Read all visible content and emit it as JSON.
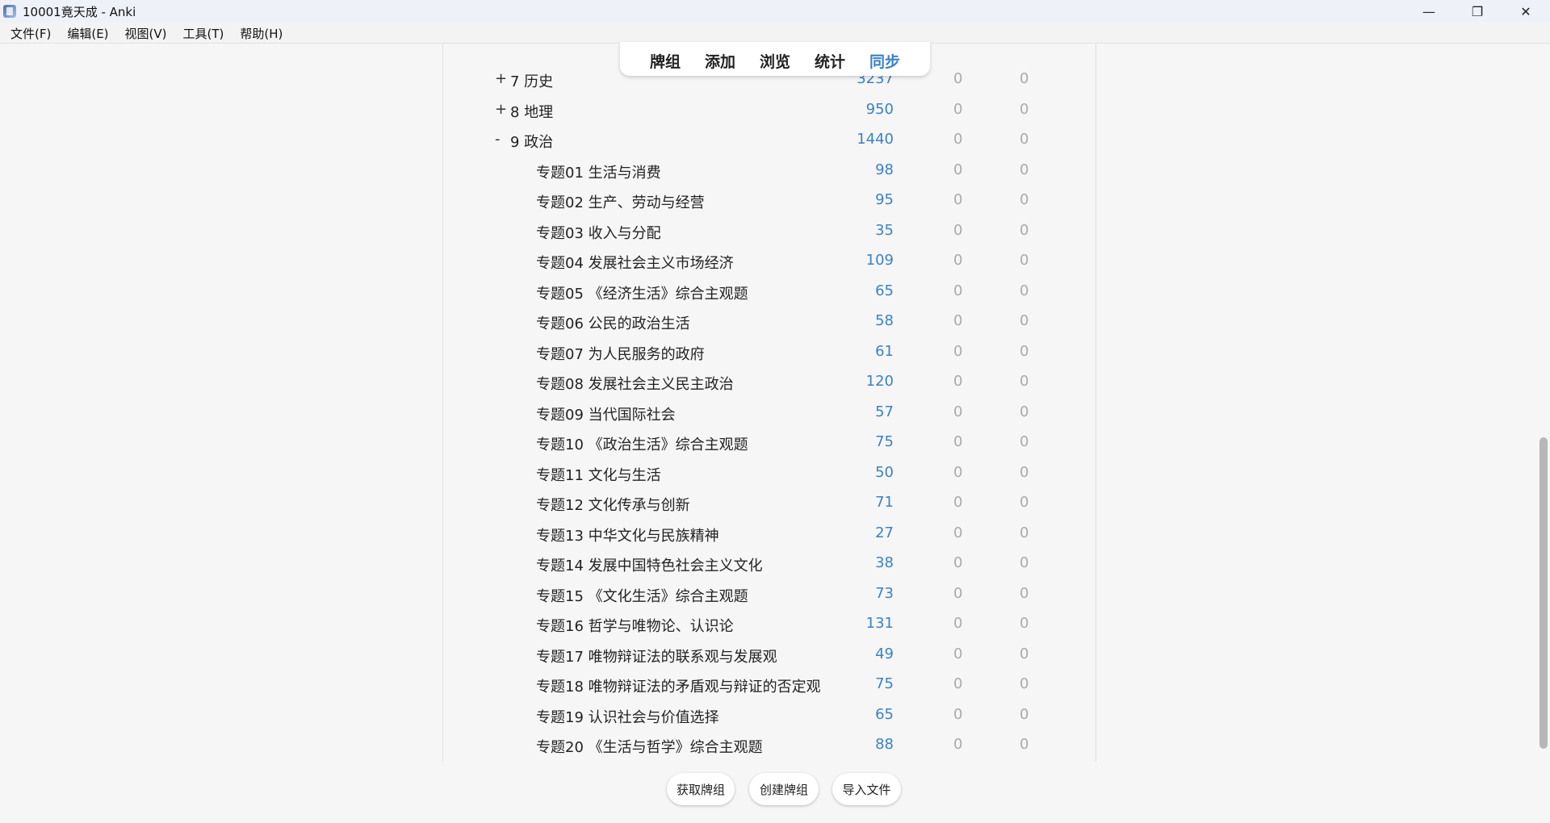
{
  "window": {
    "title": "10001竟天成 - Anki",
    "controls": {
      "minimize": "—",
      "restore": "❐",
      "close": "✕"
    },
    "app_icon": "anki-app-icon"
  },
  "menu": [
    "文件(F)",
    "编辑(E)",
    "视图(V)",
    "工具(T)",
    "帮助(H)"
  ],
  "toolbar": {
    "items": [
      "牌组",
      "添加",
      "浏览",
      "统计",
      "同步"
    ],
    "active_index": 4,
    "active_color": "#3b82c4"
  },
  "decks": [
    {
      "expander": "+",
      "name": "7 历史",
      "new": "3237",
      "learn": "0",
      "due": "0",
      "level": 0
    },
    {
      "expander": "+",
      "name": "8 地理",
      "new": "950",
      "learn": "0",
      "due": "0",
      "level": 0
    },
    {
      "expander": "-",
      "name": "9 政治",
      "new": "1440",
      "learn": "0",
      "due": "0",
      "level": 0
    },
    {
      "expander": "",
      "name": "专题01 生活与消费",
      "new": "98",
      "learn": "0",
      "due": "0",
      "level": 1
    },
    {
      "expander": "",
      "name": "专题02 生产、劳动与经营",
      "new": "95",
      "learn": "0",
      "due": "0",
      "level": 1
    },
    {
      "expander": "",
      "name": "专题03 收入与分配",
      "new": "35",
      "learn": "0",
      "due": "0",
      "level": 1
    },
    {
      "expander": "",
      "name": "专题04 发展社会主义市场经济",
      "new": "109",
      "learn": "0",
      "due": "0",
      "level": 1
    },
    {
      "expander": "",
      "name": "专题05 《经济生活》综合主观题",
      "new": "65",
      "learn": "0",
      "due": "0",
      "level": 1
    },
    {
      "expander": "",
      "name": "专题06 公民的政治生活",
      "new": "58",
      "learn": "0",
      "due": "0",
      "level": 1
    },
    {
      "expander": "",
      "name": "专题07 为人民服务的政府",
      "new": "61",
      "learn": "0",
      "due": "0",
      "level": 1
    },
    {
      "expander": "",
      "name": "专题08 发展社会主义民主政治",
      "new": "120",
      "learn": "0",
      "due": "0",
      "level": 1
    },
    {
      "expander": "",
      "name": "专题09 当代国际社会",
      "new": "57",
      "learn": "0",
      "due": "0",
      "level": 1
    },
    {
      "expander": "",
      "name": "专题10 《政治生活》综合主观题",
      "new": "75",
      "learn": "0",
      "due": "0",
      "level": 1
    },
    {
      "expander": "",
      "name": "专题11 文化与生活",
      "new": "50",
      "learn": "0",
      "due": "0",
      "level": 1
    },
    {
      "expander": "",
      "name": "专题12 文化传承与创新",
      "new": "71",
      "learn": "0",
      "due": "0",
      "level": 1
    },
    {
      "expander": "",
      "name": "专题13 中华文化与民族精神",
      "new": "27",
      "learn": "0",
      "due": "0",
      "level": 1
    },
    {
      "expander": "",
      "name": "专题14 发展中国特色社会主义文化",
      "new": "38",
      "learn": "0",
      "due": "0",
      "level": 1
    },
    {
      "expander": "",
      "name": "专题15 《文化生活》综合主观题",
      "new": "73",
      "learn": "0",
      "due": "0",
      "level": 1
    },
    {
      "expander": "",
      "name": "专题16 哲学与唯物论、认识论",
      "new": "131",
      "learn": "0",
      "due": "0",
      "level": 1
    },
    {
      "expander": "",
      "name": "专题17 唯物辩证法的联系观与发展观",
      "new": "49",
      "learn": "0",
      "due": "0",
      "level": 1
    },
    {
      "expander": "",
      "name": "专题18 唯物辩证法的矛盾观与辩证的否定观",
      "new": "75",
      "learn": "0",
      "due": "0",
      "level": 1
    },
    {
      "expander": "",
      "name": "专题19 认识社会与价值选择",
      "new": "65",
      "learn": "0",
      "due": "0",
      "level": 1
    },
    {
      "expander": "",
      "name": "专题20 《生活与哲学》综合主观题",
      "new": "88",
      "learn": "0",
      "due": "0",
      "level": 1
    }
  ],
  "bottom_buttons": [
    "获取牌组",
    "创建牌组",
    "导入文件"
  ],
  "colors": {
    "new_count": "#3b82c4",
    "zero_count": "#aaaaaa",
    "background": "#f6f6f6"
  }
}
